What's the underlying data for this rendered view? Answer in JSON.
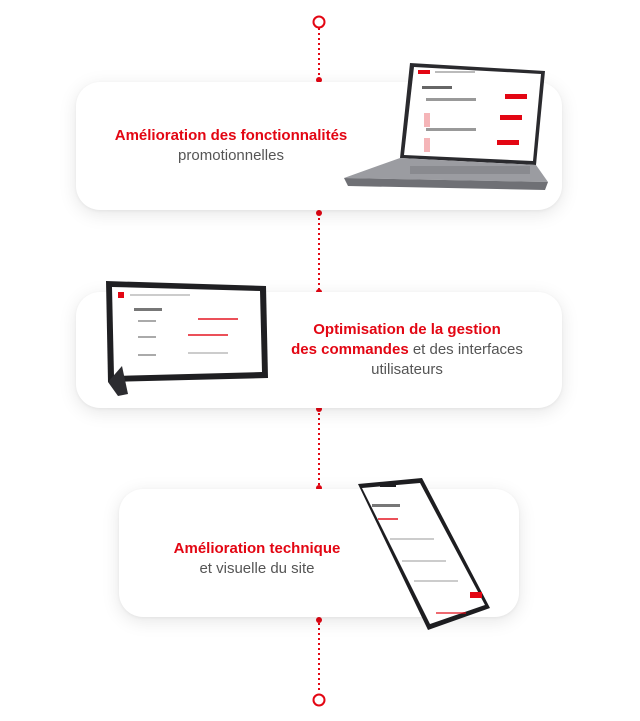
{
  "steps": [
    {
      "title_line1": "Amélioration des fonctionnalités",
      "body_line2": "promotionnelles",
      "device": "laptop"
    },
    {
      "title_line1": "Optimisation de la gestion",
      "title_line2": "des commandes",
      "body_line2_rest": " et des interfaces",
      "body_line3": "utilisateurs",
      "device": "tablet"
    },
    {
      "title_line1": "Amélioration technique",
      "body_line2": "et visuelle du site",
      "device": "phone"
    }
  ],
  "colors": {
    "accent": "#e30613",
    "text": "#555555",
    "card": "#ffffff"
  }
}
